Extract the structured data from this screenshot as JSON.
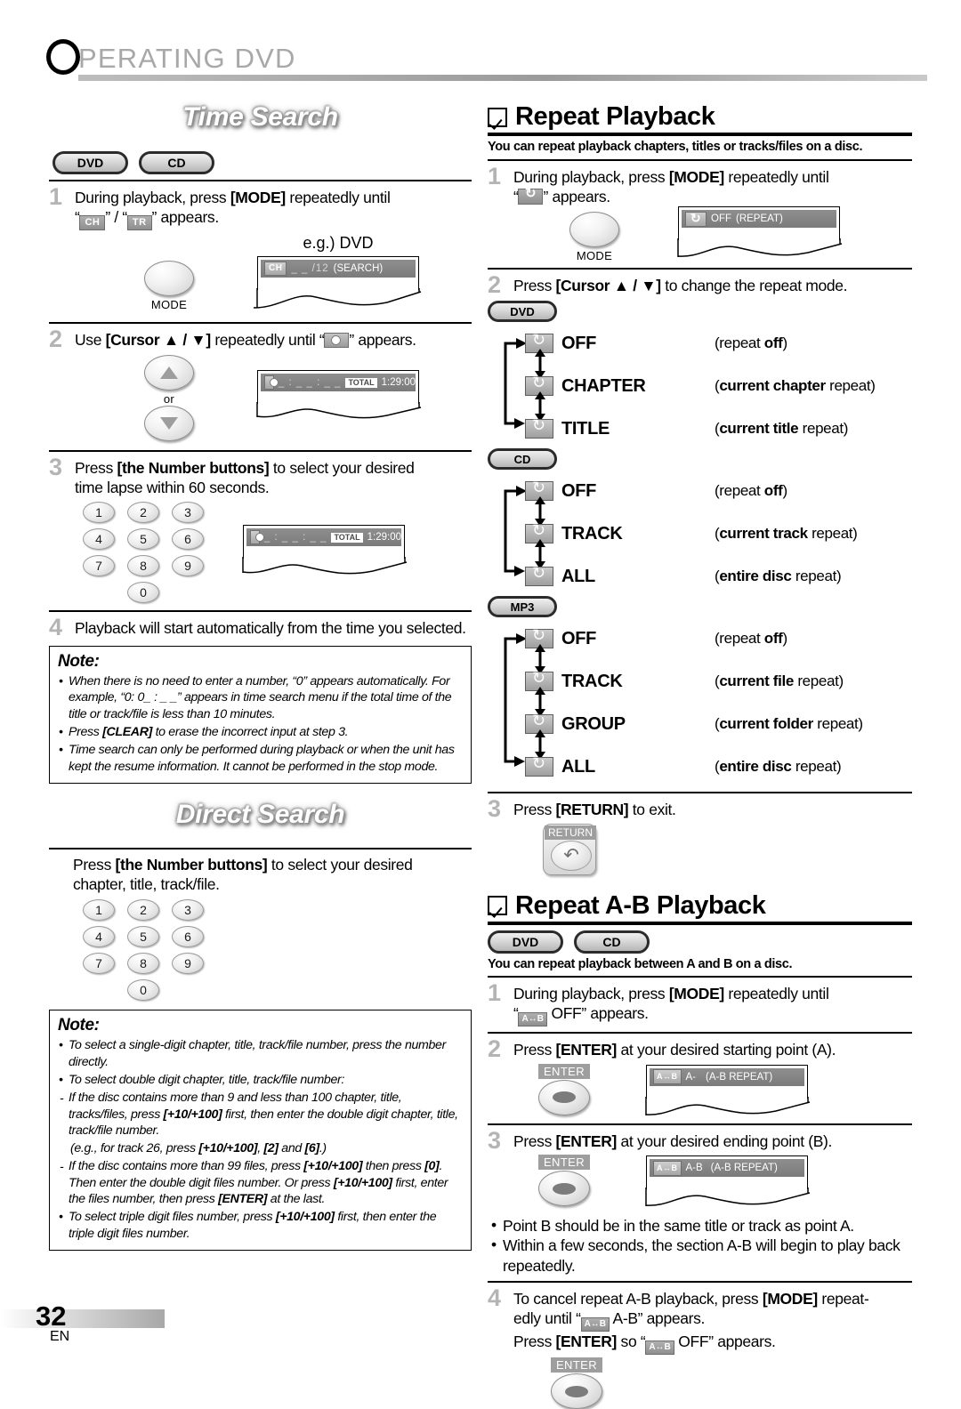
{
  "header": {
    "drop_cap": "O",
    "title": "PERATING  DVD"
  },
  "footer": {
    "page_number": "32",
    "lang": "EN"
  },
  "time_search": {
    "banner": "Time Search",
    "media": [
      "DVD",
      "CD"
    ],
    "step1": {
      "num": "1",
      "text_a": "During playback, press [MODE] repeatedly until",
      "icon_a": "CH",
      "sep": "” / “",
      "icon_b": "TR",
      "text_b": "” appears.",
      "quote_open": "“"
    },
    "eg_label": "e.g.) DVD",
    "mode_button": "MODE",
    "osd1": {
      "icon": "CH",
      "value": "_ _ /12",
      "mode": "(SEARCH)"
    },
    "step2": {
      "num": "2",
      "text": "Use [Cursor ▲ / ▼] repeatedly until “",
      "text_tail": "” appears."
    },
    "or_label": "or",
    "osd2": {
      "icon": "clock-icon",
      "value": "_ : _ _ : _ _",
      "badge": "TOTAL",
      "time": "1:29:00"
    },
    "step3": {
      "num": "3",
      "text": "Press [the Number buttons] to select your desired time lapse within 60 seconds."
    },
    "keys": [
      "1",
      "2",
      "3",
      "4",
      "5",
      "6",
      "7",
      "8",
      "9",
      "0"
    ],
    "osd3": {
      "icon": "clock-icon",
      "value": "_ : _ _ : _ _",
      "badge": "TOTAL",
      "time": "1:29:00"
    },
    "step4": {
      "num": "4",
      "text": "Playback will start automatically from the time you selected."
    },
    "note": {
      "title": "Note:",
      "items": [
        {
          "marker": "bullet",
          "text": "When there is no need to enter a number, “0” appears automatically. For example, “0: 0_ : _ _” appears in time search menu if the total time of the title or track/file is less than 10 minutes."
        },
        {
          "marker": "bullet",
          "text": "Press [CLEAR] to erase the incorrect input at step 3."
        },
        {
          "marker": "bullet",
          "text": "Time search can only be performed during playback or when the unit has kept the resume information. It cannot be performed in the stop mode."
        }
      ]
    }
  },
  "direct_search": {
    "banner": "Direct Search",
    "intro": "Press [the Number buttons] to select your desired chapter, title, track/file.",
    "keys": [
      "1",
      "2",
      "3",
      "4",
      "5",
      "6",
      "7",
      "8",
      "9",
      "0"
    ],
    "note": {
      "title": "Note:",
      "items": [
        {
          "marker": "bullet",
          "text": "To select a single-digit chapter, title, track/file number, press the number directly."
        },
        {
          "marker": "bullet",
          "text": "To select double digit chapter, title, track/file number:"
        },
        {
          "marker": "dash",
          "text": "If the disc contains more than 9 and less than 100 chapter, title, tracks/files, press [+10/+100] first, then enter the double digit chapter, title, track/file number."
        },
        {
          "marker": "none",
          "text": "(e.g., for track 26, press [+10/+100], [2] and [6].)"
        },
        {
          "marker": "dash",
          "text": "If the disc contains more than 99 files, press [+10/+100] then press [0]. Then enter the double digit files number. Or press [+10/+100] first, enter the files number, then press [ENTER] at the last."
        },
        {
          "marker": "bullet",
          "text": "To select triple digit files number, press [+10/+100] first, then enter the triple digit files number."
        }
      ]
    }
  },
  "repeat_playback": {
    "title": "Repeat Playback",
    "lead": "You can repeat playback chapters, titles or tracks/files on a disc.",
    "step1": {
      "num": "1",
      "text_a": "During playback, press [MODE] repeatedly until",
      "quote_open": "“",
      "icon": "repeat-icon",
      "text_b": "” appears."
    },
    "mode_button": "MODE",
    "osd": {
      "icon": "repeat-icon",
      "value": "OFF",
      "mode": "(REPEAT)"
    },
    "step2": {
      "num": "2",
      "text": "Press [Cursor ▲ / ▼] to change the repeat mode."
    },
    "flows": [
      {
        "media": "DVD",
        "rows": [
          {
            "label": "OFF",
            "desc_pre": "(repeat ",
            "desc_bold": "off",
            "desc_post": ")"
          },
          {
            "label": "CHAPTER",
            "desc_pre": "(",
            "desc_bold": "current chapter",
            "desc_post": " repeat)"
          },
          {
            "label": "TITLE",
            "desc_pre": "(",
            "desc_bold": "current title",
            "desc_post": " repeat)"
          }
        ]
      },
      {
        "media": "CD",
        "rows": [
          {
            "label": "OFF",
            "desc_pre": "(repeat ",
            "desc_bold": "off",
            "desc_post": ")"
          },
          {
            "label": "TRACK",
            "desc_pre": "(",
            "desc_bold": "current track",
            "desc_post": " repeat)"
          },
          {
            "label": "ALL",
            "desc_pre": "(",
            "desc_bold": "entire disc",
            "desc_post": " repeat)"
          }
        ]
      },
      {
        "media": "MP3",
        "rows": [
          {
            "label": "OFF",
            "desc_pre": "(repeat ",
            "desc_bold": "off",
            "desc_post": ")"
          },
          {
            "label": "TRACK",
            "desc_pre": "(",
            "desc_bold": "current file",
            "desc_post": " repeat)"
          },
          {
            "label": "GROUP",
            "desc_pre": "(",
            "desc_bold": "current folder",
            "desc_post": " repeat)"
          },
          {
            "label": "ALL",
            "desc_pre": "(",
            "desc_bold": "entire disc",
            "desc_post": " repeat)"
          }
        ]
      }
    ],
    "step3": {
      "num": "3",
      "text": "Press [RETURN] to exit."
    },
    "return_button": "RETURN"
  },
  "repeat_ab": {
    "title": "Repeat A-B Playback",
    "media": [
      "DVD",
      "CD"
    ],
    "lead": "You can repeat playback between A and B on a disc.",
    "step1": {
      "num": "1",
      "text_a": "During playback, press [MODE] repeatedly until",
      "quote_open": "“",
      "icon": "ab-icon",
      "text_b": " OFF” appears."
    },
    "step2": {
      "num": "2",
      "text": "Press [ENTER] at your desired starting point (A)."
    },
    "enter_button": "ENTER",
    "osd_a": {
      "icon": "ab-icon",
      "value": "A-",
      "mode": "(A-B REPEAT)"
    },
    "step3": {
      "num": "3",
      "text": "Press [ENTER] at your desired ending point (B)."
    },
    "osd_b": {
      "icon": "ab-icon",
      "value": "A-B",
      "mode": "(A-B REPEAT)"
    },
    "bullets": [
      "Point B should be in the same title or track as point A.",
      "Within a few seconds, the section A-B will begin to play back repeatedly."
    ],
    "step4": {
      "num": "4",
      "text_a": "To cancel repeat A-B playback, press [MODE] repeat-edly until “",
      "icon": "ab-icon",
      "text_b": " A-B” appears.",
      "text_c": "Press [ENTER] so “",
      "icon2": "ab-icon",
      "text_d": " OFF” appears."
    }
  }
}
